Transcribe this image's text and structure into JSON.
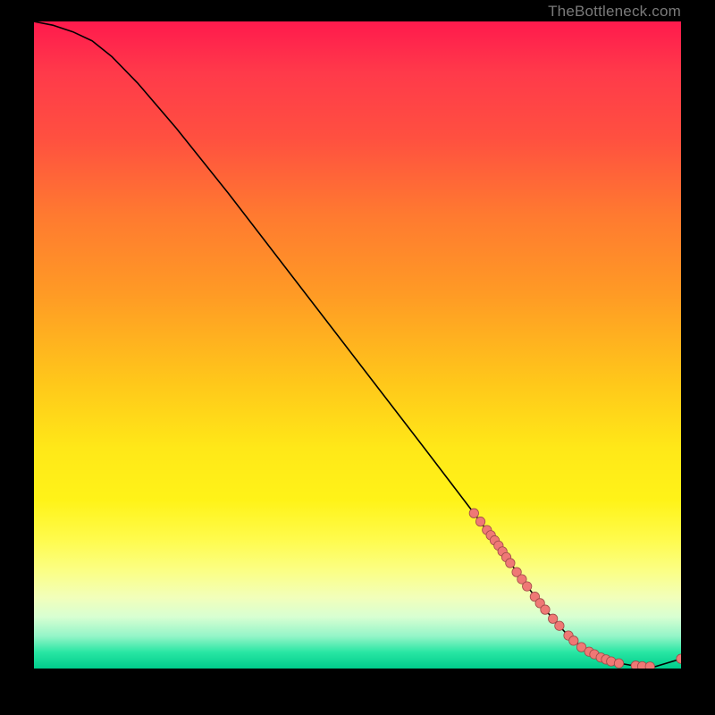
{
  "attribution": "TheBottleneck.com",
  "colors": {
    "curve": "#000000",
    "dot_fill": "#ef7875",
    "dot_stroke": "#a04a48"
  },
  "chart_data": {
    "type": "line",
    "title": "",
    "xlabel": "",
    "ylabel": "",
    "xlim": [
      0,
      100
    ],
    "ylim": [
      0,
      100
    ],
    "grid": false,
    "legend": false,
    "series": [
      {
        "name": "bottleneck-curve",
        "x": [
          0,
          3,
          6,
          9,
          12,
          16,
          22,
          30,
          40,
          50,
          60,
          68,
          72,
          74,
          76,
          78,
          80,
          82,
          84,
          86,
          88,
          90,
          92,
          94,
          96,
          100
        ],
        "y": [
          100,
          99.4,
          98.4,
          97.0,
          94.6,
          90.5,
          83.5,
          73.5,
          60.5,
          47.5,
          34.5,
          24.0,
          18.6,
          15.8,
          13.0,
          10.4,
          7.9,
          5.7,
          3.9,
          2.5,
          1.5,
          0.9,
          0.55,
          0.35,
          0.3,
          1.5
        ]
      }
    ],
    "dots": [
      {
        "x": 68.0,
        "y": 24.0
      },
      {
        "x": 69.0,
        "y": 22.7
      },
      {
        "x": 70.0,
        "y": 21.4
      },
      {
        "x": 70.6,
        "y": 20.6
      },
      {
        "x": 71.2,
        "y": 19.8
      },
      {
        "x": 71.8,
        "y": 19.0
      },
      {
        "x": 72.4,
        "y": 18.1
      },
      {
        "x": 73.0,
        "y": 17.2
      },
      {
        "x": 73.6,
        "y": 16.3
      },
      {
        "x": 74.6,
        "y": 14.9
      },
      {
        "x": 75.4,
        "y": 13.8
      },
      {
        "x": 76.2,
        "y": 12.7
      },
      {
        "x": 77.4,
        "y": 11.1
      },
      {
        "x": 78.2,
        "y": 10.1
      },
      {
        "x": 79.0,
        "y": 9.1
      },
      {
        "x": 80.2,
        "y": 7.7
      },
      {
        "x": 81.2,
        "y": 6.6
      },
      {
        "x": 82.6,
        "y": 5.1
      },
      {
        "x": 83.4,
        "y": 4.3
      },
      {
        "x": 84.6,
        "y": 3.3
      },
      {
        "x": 85.8,
        "y": 2.6
      },
      {
        "x": 86.6,
        "y": 2.2
      },
      {
        "x": 87.6,
        "y": 1.7
      },
      {
        "x": 88.4,
        "y": 1.4
      },
      {
        "x": 89.2,
        "y": 1.1
      },
      {
        "x": 90.4,
        "y": 0.8
      },
      {
        "x": 93.0,
        "y": 0.45
      },
      {
        "x": 94.0,
        "y": 0.35
      },
      {
        "x": 95.2,
        "y": 0.3
      },
      {
        "x": 100.0,
        "y": 1.5
      }
    ]
  }
}
